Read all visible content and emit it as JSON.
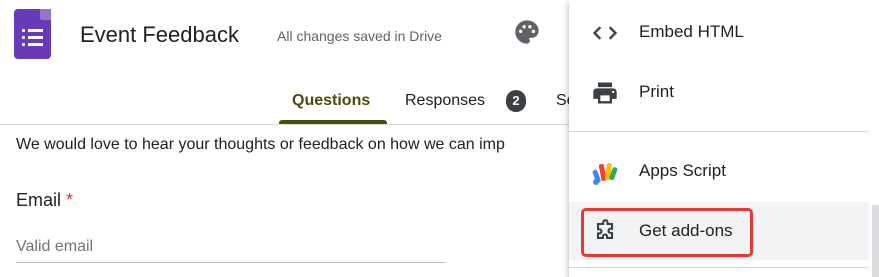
{
  "header": {
    "app_icon": "google-forms-icon",
    "title": "Event Feedback",
    "save_status": "All changes saved in Drive",
    "palette_icon": "palette-icon"
  },
  "tabs": [
    {
      "label": "Questions",
      "active": true
    },
    {
      "label": "Responses",
      "badge": "2"
    },
    {
      "label": "Se"
    }
  ],
  "form": {
    "description": "We would love to hear your thoughts or feedback on how we can imp",
    "email_label": "Email",
    "required_marker": "*",
    "email_placeholder": "Valid email"
  },
  "menu": {
    "items": [
      {
        "label": "Embed HTML",
        "icon": "code-icon"
      },
      {
        "label": "Print",
        "icon": "printer-icon"
      },
      {
        "label": "Apps Script",
        "icon": "apps-script-icon"
      },
      {
        "label": "Get add-ons",
        "icon": "puzzle-piece-icon",
        "highlighted": true
      }
    ]
  },
  "colors": {
    "brand": "#673ab7",
    "tab_active": "#4d4d0a",
    "required": "#d93025",
    "highlight_border": "#e53935"
  }
}
